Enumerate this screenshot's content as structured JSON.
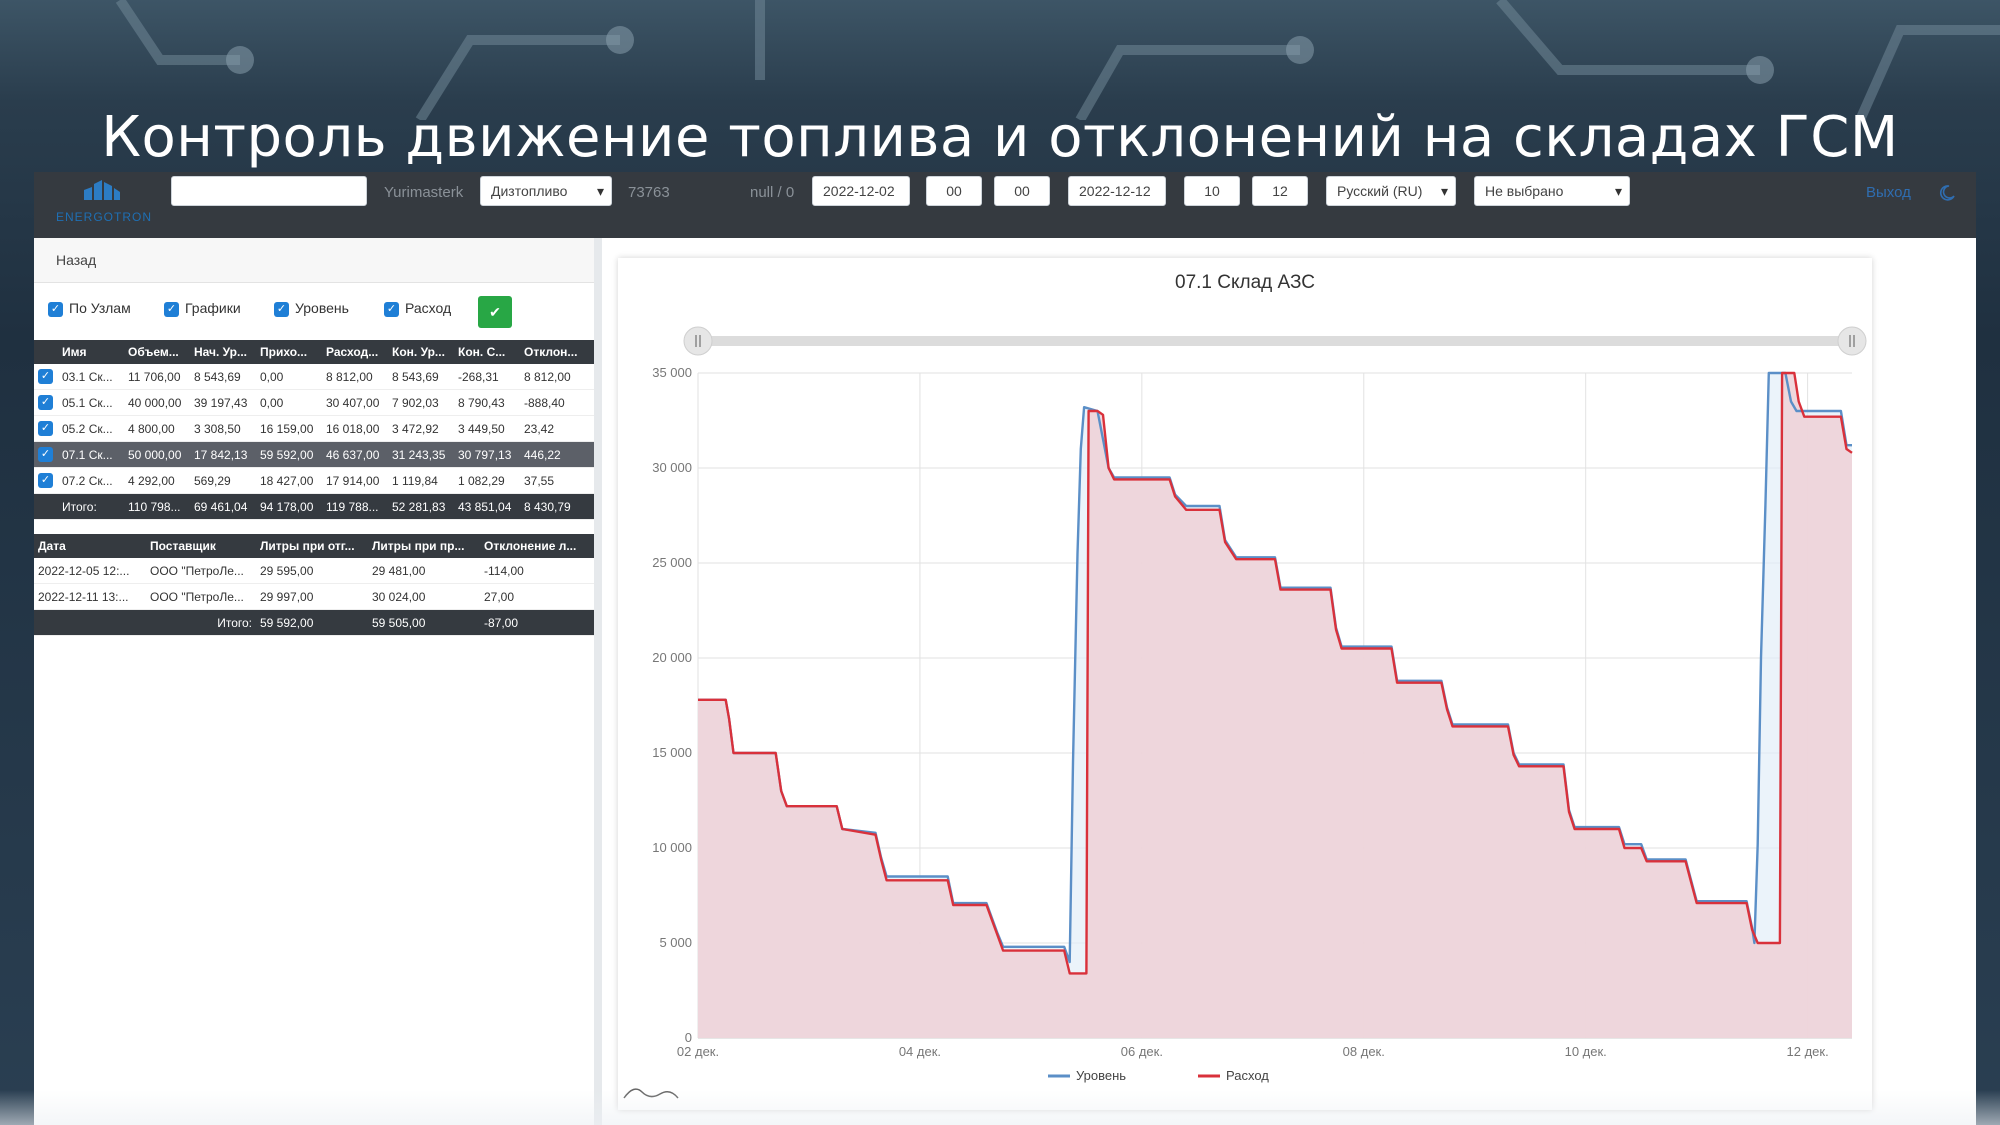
{
  "slide": {
    "title": "Контроль движение топлива и отклонений на складах ГСМ"
  },
  "topbar": {
    "logo_text": "ENERGOTRON",
    "search_value": "",
    "username": "Yurimasterk",
    "fuel_select": "Дизтопливо",
    "code": "73763",
    "null_text": "null / 0",
    "date_from": "2022-12-02",
    "hour_from": "00",
    "min_from": "00",
    "date_to": "2022-12-12",
    "hour_to": "10",
    "min_to": "12",
    "language_select": "Русский (RU)",
    "node_select": "Не выбрано",
    "logout": "Выход"
  },
  "left": {
    "back": "Назад",
    "filters": [
      "По Узлам",
      "Графики",
      "Уровень",
      "Расход"
    ],
    "ok_glyph": "✔",
    "warehouse_table": {
      "headers": [
        "Имя",
        "Объем...",
        "Нач. Ур...",
        "Прихо...",
        "Расход...",
        "Кон. Ур...",
        "Кон. С...",
        "Отклон..."
      ],
      "rows": [
        [
          "03.1 Ск...",
          "11 706,00",
          "8 543,69",
          "0,00",
          "8 812,00",
          "8 543,69",
          "-268,31",
          "8 812,00"
        ],
        [
          "05.1 Ск...",
          "40 000,00",
          "39 197,43",
          "0,00",
          "30 407,00",
          "7 902,03",
          "8 790,43",
          "-888,40"
        ],
        [
          "05.2 Ск...",
          "4 800,00",
          "3 308,50",
          "16 159,00",
          "16 018,00",
          "3 472,92",
          "3 449,50",
          "23,42"
        ],
        [
          "07.1 Ск...",
          "50 000,00",
          "17 842,13",
          "59 592,00",
          "46 637,00",
          "31 243,35",
          "30 797,13",
          "446,22"
        ],
        [
          "07.2 Ск...",
          "4 292,00",
          "569,29",
          "18 427,00",
          "17 914,00",
          "1 119,84",
          "1 082,29",
          "37,55"
        ]
      ],
      "total": [
        "Итого:",
        "110 798...",
        "69 461,04",
        "94 178,00",
        "119 788...",
        "52 281,83",
        "43 851,04",
        "8 430,79"
      ]
    },
    "supply_table": {
      "headers": [
        "Дата",
        "Поставщик",
        "Литры при отг...",
        "Литры при пр...",
        "Отклонение л..."
      ],
      "rows": [
        [
          "2022-12-05 12:...",
          "ООО \"ПетроЛе...",
          "29 595,00",
          "29 481,00",
          "-114,00"
        ],
        [
          "2022-12-11 13:...",
          "ООО \"ПетроЛе...",
          "29 997,00",
          "30 024,00",
          "27,00"
        ]
      ],
      "total": [
        "",
        "Итого:",
        "59 592,00",
        "59 505,00",
        "-87,00"
      ]
    }
  },
  "chart_data": {
    "type": "line",
    "title": "07.1 Склад АЗС",
    "ylim": [
      0,
      35000
    ],
    "yticks": [
      "0",
      "5 000",
      "10 000",
      "15 000",
      "20 000",
      "25 000",
      "30 000",
      "35 000"
    ],
    "xlim": [
      0,
      10.4
    ],
    "xticks": [
      {
        "x": 0,
        "label": "02 дек."
      },
      {
        "x": 2,
        "label": "04 дек."
      },
      {
        "x": 4,
        "label": "06 дек."
      },
      {
        "x": 6,
        "label": "08 дек."
      },
      {
        "x": 8,
        "label": "10 дек."
      },
      {
        "x": 10,
        "label": "12 дек."
      }
    ],
    "grid": true,
    "legend_position": "bottom",
    "series": [
      {
        "name": "Уровень",
        "color": "#5b8fc7",
        "points": [
          [
            0,
            17800
          ],
          [
            0.25,
            17800
          ],
          [
            0.28,
            16800
          ],
          [
            0.32,
            15000
          ],
          [
            0.7,
            15000
          ],
          [
            0.75,
            13000
          ],
          [
            0.8,
            12200
          ],
          [
            1.25,
            12200
          ],
          [
            1.3,
            11000
          ],
          [
            1.6,
            10800
          ],
          [
            1.65,
            9500
          ],
          [
            1.7,
            8500
          ],
          [
            2.25,
            8500
          ],
          [
            2.3,
            7100
          ],
          [
            2.6,
            7100
          ],
          [
            2.65,
            6300
          ],
          [
            2.7,
            5500
          ],
          [
            2.75,
            4800
          ],
          [
            3.3,
            4800
          ],
          [
            3.35,
            4000
          ],
          [
            3.38,
            14500
          ],
          [
            3.42,
            25500
          ],
          [
            3.45,
            31000
          ],
          [
            3.48,
            33200
          ],
          [
            3.6,
            33000
          ],
          [
            3.7,
            30000
          ],
          [
            3.75,
            29500
          ],
          [
            4.25,
            29500
          ],
          [
            4.3,
            28600
          ],
          [
            4.4,
            28000
          ],
          [
            4.7,
            28000
          ],
          [
            4.75,
            26200
          ],
          [
            4.85,
            25300
          ],
          [
            5.2,
            25300
          ],
          [
            5.25,
            23700
          ],
          [
            5.7,
            23700
          ],
          [
            5.75,
            21600
          ],
          [
            5.8,
            20600
          ],
          [
            6.25,
            20600
          ],
          [
            6.3,
            18800
          ],
          [
            6.7,
            18800
          ],
          [
            6.75,
            17400
          ],
          [
            6.8,
            16500
          ],
          [
            7.3,
            16500
          ],
          [
            7.35,
            15000
          ],
          [
            7.4,
            14400
          ],
          [
            7.8,
            14400
          ],
          [
            7.85,
            12000
          ],
          [
            7.9,
            11100
          ],
          [
            8.3,
            11100
          ],
          [
            8.35,
            10200
          ],
          [
            8.5,
            10200
          ],
          [
            8.55,
            9400
          ],
          [
            8.9,
            9400
          ],
          [
            8.95,
            8300
          ],
          [
            9,
            7200
          ],
          [
            9.45,
            7200
          ],
          [
            9.5,
            5800
          ],
          [
            9.52,
            5000
          ],
          [
            9.55,
            10200
          ],
          [
            9.58,
            20000
          ],
          [
            9.62,
            28000
          ],
          [
            9.65,
            35000
          ],
          [
            9.8,
            35000
          ],
          [
            9.85,
            33500
          ],
          [
            9.9,
            33000
          ],
          [
            10.3,
            33000
          ],
          [
            10.35,
            31200
          ],
          [
            10.4,
            31200
          ]
        ]
      },
      {
        "name": "Расход",
        "color": "#d9313b",
        "fill": "#eed3d8",
        "points": [
          [
            0,
            17800
          ],
          [
            0.25,
            17800
          ],
          [
            0.28,
            16800
          ],
          [
            0.32,
            15000
          ],
          [
            0.7,
            15000
          ],
          [
            0.75,
            13000
          ],
          [
            0.8,
            12200
          ],
          [
            1.25,
            12200
          ],
          [
            1.3,
            11000
          ],
          [
            1.6,
            10700
          ],
          [
            1.65,
            9400
          ],
          [
            1.7,
            8300
          ],
          [
            2.25,
            8300
          ],
          [
            2.3,
            7000
          ],
          [
            2.6,
            7000
          ],
          [
            2.65,
            6200
          ],
          [
            2.7,
            5400
          ],
          [
            2.75,
            4600
          ],
          [
            3.3,
            4600
          ],
          [
            3.35,
            3400
          ],
          [
            3.5,
            3400
          ],
          [
            3.52,
            33000
          ],
          [
            3.6,
            33000
          ],
          [
            3.65,
            32800
          ],
          [
            3.7,
            30000
          ],
          [
            3.75,
            29400
          ],
          [
            4.25,
            29400
          ],
          [
            4.3,
            28500
          ],
          [
            4.4,
            27800
          ],
          [
            4.7,
            27800
          ],
          [
            4.75,
            26100
          ],
          [
            4.85,
            25200
          ],
          [
            5.2,
            25200
          ],
          [
            5.25,
            23600
          ],
          [
            5.7,
            23600
          ],
          [
            5.75,
            21500
          ],
          [
            5.8,
            20500
          ],
          [
            6.25,
            20500
          ],
          [
            6.3,
            18700
          ],
          [
            6.7,
            18700
          ],
          [
            6.75,
            17300
          ],
          [
            6.8,
            16400
          ],
          [
            7.3,
            16400
          ],
          [
            7.35,
            14900
          ],
          [
            7.4,
            14300
          ],
          [
            7.8,
            14300
          ],
          [
            7.85,
            11900
          ],
          [
            7.9,
            11000
          ],
          [
            8.3,
            11000
          ],
          [
            8.35,
            10000
          ],
          [
            8.5,
            10000
          ],
          [
            8.55,
            9300
          ],
          [
            8.9,
            9300
          ],
          [
            8.95,
            8200
          ],
          [
            9,
            7100
          ],
          [
            9.45,
            7100
          ],
          [
            9.5,
            5700
          ],
          [
            9.55,
            5000
          ],
          [
            9.75,
            5000
          ],
          [
            9.77,
            35000
          ],
          [
            9.88,
            35000
          ],
          [
            9.92,
            33500
          ],
          [
            9.97,
            32700
          ],
          [
            10.3,
            32700
          ],
          [
            10.35,
            31000
          ],
          [
            10.4,
            30800
          ]
        ]
      }
    ]
  }
}
